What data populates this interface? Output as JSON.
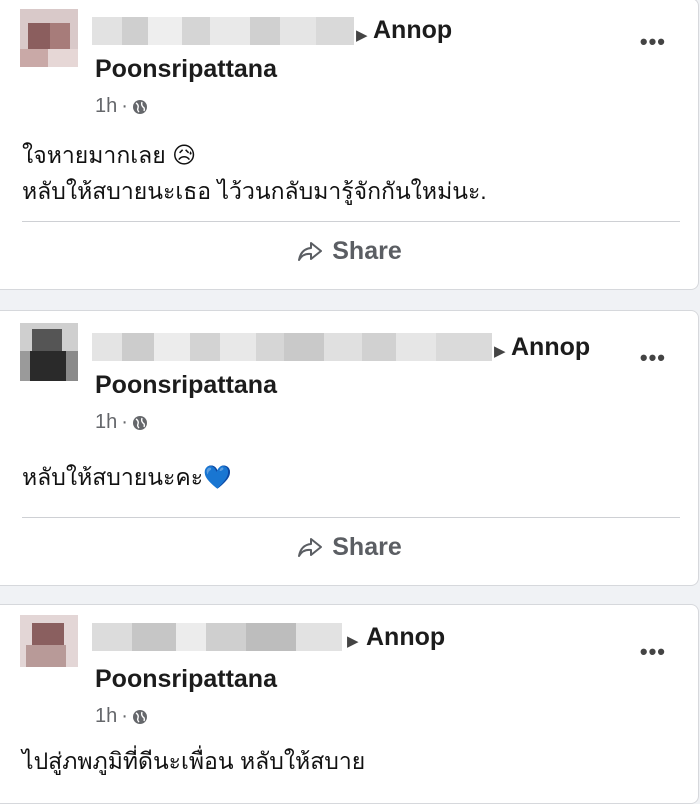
{
  "posts": [
    {
      "target_line1": "Annop",
      "target_line2": "Poonsripattana",
      "time": "1h",
      "sep": "·",
      "more": "•••",
      "text_line1": "ใจหายมากเลย 😥",
      "text_line2": "หลับให้สบายนะเธอ ไว้วนกลับมารู้จักกันใหม่นะ.",
      "share": "Share"
    },
    {
      "target_line1": "Annop",
      "target_line2": "Poonsripattana",
      "time": "1h",
      "sep": "·",
      "more": "•••",
      "text_line1": "หลับให้สบายนะคะ💙",
      "share": "Share"
    },
    {
      "target_line1": "Annop",
      "target_line2": "Poonsripattana",
      "time": "1h",
      "sep": "·",
      "more": "•••",
      "text_line1": "ไปสู่ภพภูมิที่ดีนะเพื่อน หลับให้สบาย"
    }
  ],
  "icons": {
    "arrow": "arrow-right-icon",
    "globe": "globe-icon",
    "share": "share-icon",
    "more": "more-options-icon"
  },
  "colors": {
    "background": "#f0f2f5",
    "card": "#ffffff",
    "meta_text": "#65676b"
  }
}
